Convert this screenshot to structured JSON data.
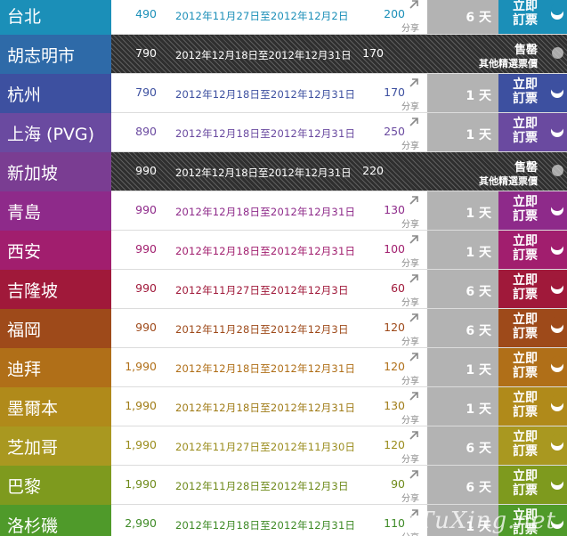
{
  "share_label": "分享",
  "book_line1": "立即",
  "book_line2": "訂票",
  "sold_line1": "售罄",
  "sold_line2": "其他精選票價",
  "watermark": "eTuXing.net",
  "rows": [
    {
      "city": "台北",
      "price": "490",
      "dates": "2012年11月27日至2012年12月2日",
      "tax": "200",
      "days": "6 天",
      "color": "#1b8fb8",
      "text_color": "#1b8fb8",
      "sold_out": false
    },
    {
      "city": "胡志明市",
      "price": "790",
      "dates": "2012年12月18日至2012年12月31日",
      "tax": "170",
      "days": "",
      "color": "#2e6aa8",
      "text_color": "#ffffff",
      "sold_out": true
    },
    {
      "city": "杭州",
      "price": "790",
      "dates": "2012年12月18日至2012年12月31日",
      "tax": "170",
      "days": "1 天",
      "color": "#3d50a0",
      "text_color": "#3d50a0",
      "sold_out": false
    },
    {
      "city": "上海 (PVG)",
      "price": "890",
      "dates": "2012年12月18日至2012年12月31日",
      "tax": "250",
      "days": "1 天",
      "color": "#6a4aa0",
      "text_color": "#6a4aa0",
      "sold_out": false
    },
    {
      "city": "新加坡",
      "price": "990",
      "dates": "2012年12月18日至2012年12月31日",
      "tax": "220",
      "days": "",
      "color": "#7a3d92",
      "text_color": "#ffffff",
      "sold_out": true
    },
    {
      "city": "青島",
      "price": "990",
      "dates": "2012年12月18日至2012年12月31日",
      "tax": "130",
      "days": "1 天",
      "color": "#8e2a8a",
      "text_color": "#8e2a8a",
      "sold_out": false
    },
    {
      "city": "西安",
      "price": "990",
      "dates": "2012年12月18日至2012年12月31日",
      "tax": "100",
      "days": "1 天",
      "color": "#a11e6e",
      "text_color": "#a11e6e",
      "sold_out": false
    },
    {
      "city": "吉隆坡",
      "price": "990",
      "dates": "2012年11月27日至2012年12月3日",
      "tax": "60",
      "days": "6 天",
      "color": "#a0193a",
      "text_color": "#a0193a",
      "sold_out": false
    },
    {
      "city": "福岡",
      "price": "990",
      "dates": "2012年11月28日至2012年12月3日",
      "tax": "120",
      "days": "6 天",
      "color": "#9e4a1a",
      "text_color": "#9e4a1a",
      "sold_out": false
    },
    {
      "city": "迪拜",
      "price": "1,990",
      "dates": "2012年12月18日至2012年12月31日",
      "tax": "120",
      "days": "1 天",
      "color": "#b06f18",
      "text_color": "#b06f18",
      "sold_out": false
    },
    {
      "city": "墨爾本",
      "price": "1,990",
      "dates": "2012年12月18日至2012年12月31日",
      "tax": "130",
      "days": "1 天",
      "color": "#b08a1a",
      "text_color": "#a07c18",
      "sold_out": false
    },
    {
      "city": "芝加哥",
      "price": "1,990",
      "dates": "2012年11月27日至2012年11月30日",
      "tax": "120",
      "days": "6 天",
      "color": "#a99820",
      "text_color": "#9a8c1c",
      "sold_out": false
    },
    {
      "city": "巴黎",
      "price": "1,990",
      "dates": "2012年11月28日至2012年12月3日",
      "tax": "90",
      "days": "6 天",
      "color": "#7e9a1e",
      "text_color": "#6e8a1a",
      "sold_out": false
    },
    {
      "city": "洛杉磯",
      "price": "2,990",
      "dates": "2012年12月18日至2012年12月31日",
      "tax": "110",
      "days": "1 天",
      "color": "#4f9a2a",
      "text_color": "#3e8a26",
      "sold_out": false
    }
  ]
}
